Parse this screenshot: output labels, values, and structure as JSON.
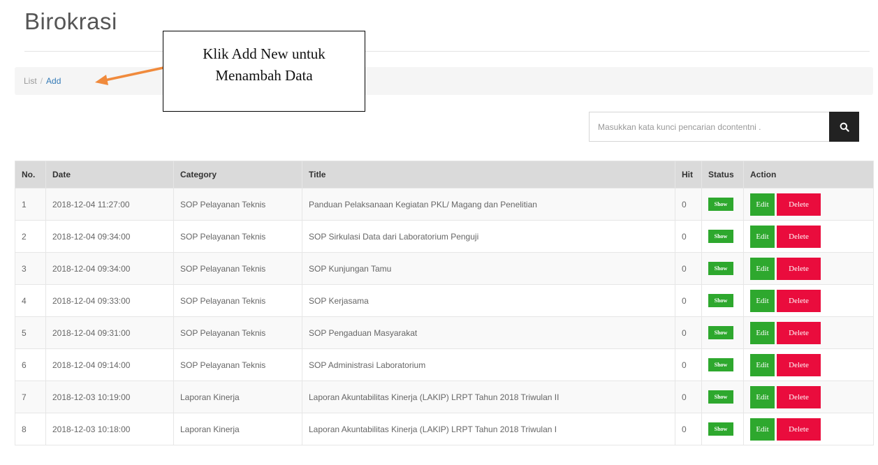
{
  "page": {
    "title": "Birokrasi"
  },
  "breadcrumb": {
    "list": "List",
    "separator": "/",
    "add": "Add"
  },
  "callout": {
    "line1": "Klik Add New untuk",
    "line2": "Menambah Data"
  },
  "colors": {
    "arrow": "#f08a3c",
    "show": "#2ea82e",
    "edit": "#2ea82e",
    "delete": "#ea0c3d",
    "search_button": "#222222"
  },
  "search": {
    "placeholder": "Masukkan kata kunci pencarian dcontentni .",
    "icon": "search-icon"
  },
  "table": {
    "headers": {
      "no": "No.",
      "date": "Date",
      "category": "Category",
      "title": "Title",
      "hit": "Hit",
      "status": "Status",
      "action": "Action"
    },
    "rows": [
      {
        "no": "1",
        "date": "2018-12-04 11:27:00",
        "category": "SOP Pelayanan Teknis",
        "title": "Panduan Pelaksanaan Kegiatan PKL/ Magang dan Penelitian",
        "hit": "0",
        "status": "Show",
        "edit": "Edit",
        "delete": "Delete"
      },
      {
        "no": "2",
        "date": "2018-12-04 09:34:00",
        "category": "SOP Pelayanan Teknis",
        "title": "SOP Sirkulasi Data dari Laboratorium Penguji",
        "hit": "0",
        "status": "Show",
        "edit": "Edit",
        "delete": "Delete"
      },
      {
        "no": "3",
        "date": "2018-12-04 09:34:00",
        "category": "SOP Pelayanan Teknis",
        "title": "SOP Kunjungan Tamu",
        "hit": "0",
        "status": "Show",
        "edit": "Edit",
        "delete": "Delete"
      },
      {
        "no": "4",
        "date": "2018-12-04 09:33:00",
        "category": "SOP Pelayanan Teknis",
        "title": "SOP Kerjasama",
        "hit": "0",
        "status": "Show",
        "edit": "Edit",
        "delete": "Delete"
      },
      {
        "no": "5",
        "date": "2018-12-04 09:31:00",
        "category": "SOP Pelayanan Teknis",
        "title": "SOP Pengaduan Masyarakat",
        "hit": "0",
        "status": "Show",
        "edit": "Edit",
        "delete": "Delete"
      },
      {
        "no": "6",
        "date": "2018-12-04 09:14:00",
        "category": "SOP Pelayanan Teknis",
        "title": "SOP Administrasi Laboratorium",
        "hit": "0",
        "status": "Show",
        "edit": "Edit",
        "delete": "Delete"
      },
      {
        "no": "7",
        "date": "2018-12-03 10:19:00",
        "category": "Laporan Kinerja",
        "title": "Laporan Akuntabilitas Kinerja (LAKIP) LRPT Tahun 2018 Triwulan II",
        "hit": "0",
        "status": "Show",
        "edit": "Edit",
        "delete": "Delete"
      },
      {
        "no": "8",
        "date": "2018-12-03 10:18:00",
        "category": "Laporan Kinerja",
        "title": "Laporan Akuntabilitas Kinerja (LAKIP) LRPT Tahun 2018 Triwulan I",
        "hit": "0",
        "status": "Show",
        "edit": "Edit",
        "delete": "Delete"
      }
    ]
  }
}
